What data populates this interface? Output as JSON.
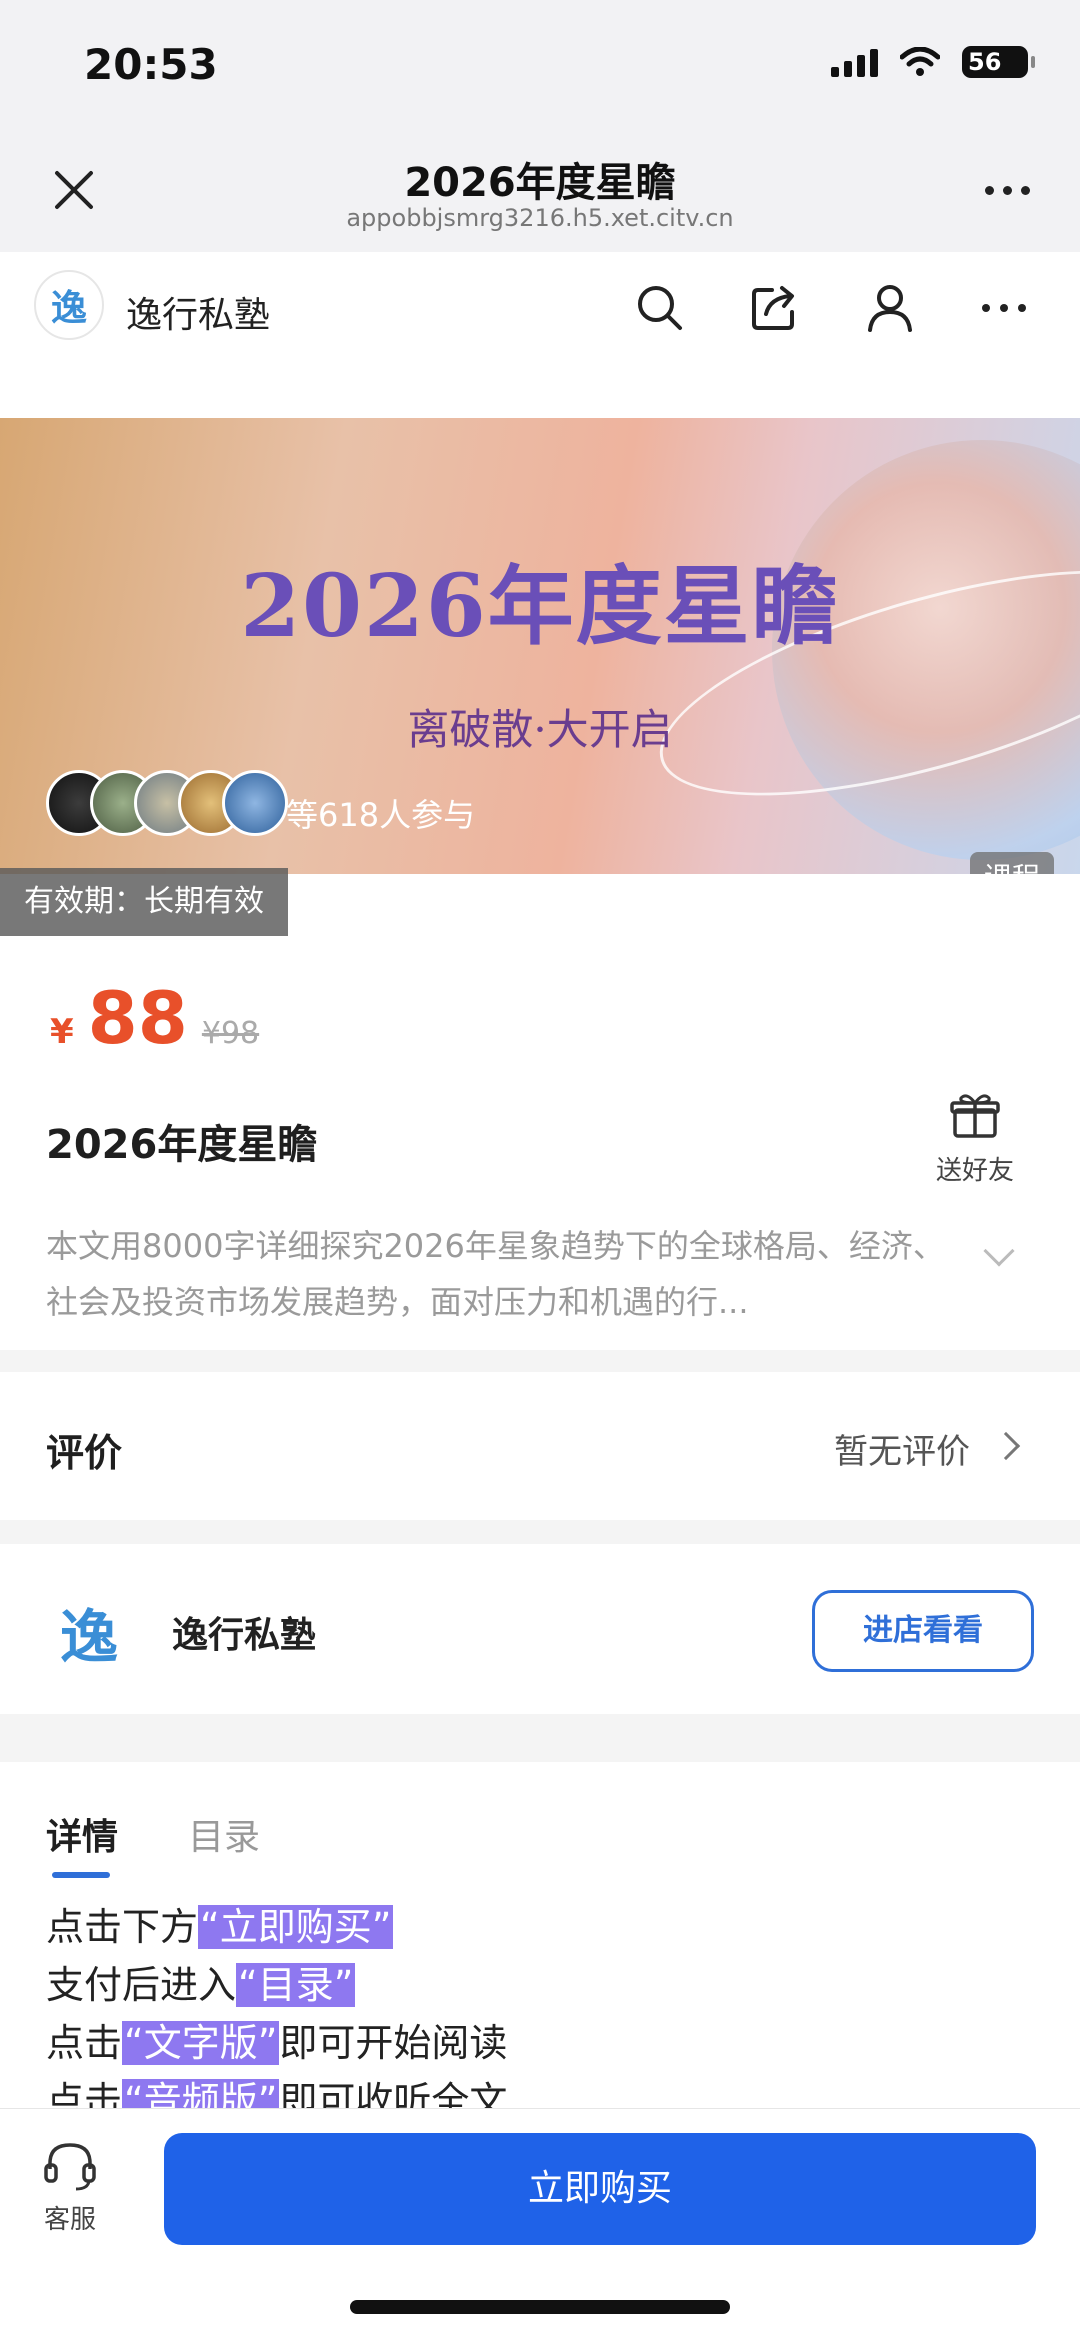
{
  "status_bar": {
    "time": "20:53",
    "battery": "56"
  },
  "browser": {
    "title": "2026年度星瞻",
    "url": "appobbjsmrg3216.h5.xet.citv.cn"
  },
  "app_header": {
    "logo_char": "逸",
    "name": "逸行私塾"
  },
  "banner": {
    "title": "2026年度星瞻",
    "subtitle": "离破散·大开启",
    "participants": "等618人参与",
    "tag": "课程",
    "validity": "有效期：长期有效"
  },
  "price": {
    "currency": "¥",
    "current": "88",
    "original": "¥98",
    "color": "#e8502a"
  },
  "course": {
    "title": "2026年度星瞻",
    "gift_label": "送好友",
    "description": "本文用8000字详细探究2026年星象趋势下的全球格局、经济、社会及投资市场发展趋势，面对压力和机遇的行..."
  },
  "review": {
    "label": "评价",
    "value": "暂无评价"
  },
  "shop": {
    "logo_char": "逸",
    "name": "逸行私塾",
    "button": "进店看看"
  },
  "tabs": {
    "active": "详情",
    "inactive": "目录"
  },
  "detail_lines": [
    {
      "pre": "点击下方",
      "hl": "“立即购买”",
      "post": ""
    },
    {
      "pre": "支付后进入",
      "hl": "“目录”",
      "post": ""
    },
    {
      "pre": "点击",
      "hl": "“文字版”",
      "post": "即可开始阅读"
    },
    {
      "pre": "点击",
      "hl": "“音频版”",
      "post": "即可收听全文"
    }
  ],
  "bottom": {
    "service_label": "客服",
    "buy_button": "立即购买",
    "accent": "#1f62e8"
  }
}
